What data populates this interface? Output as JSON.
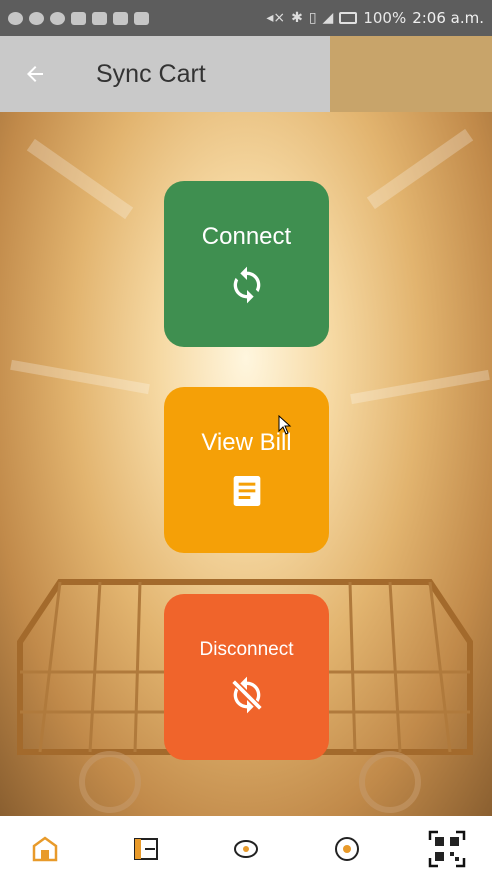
{
  "status_bar": {
    "battery_percent": "100%",
    "time": "2:06 a.m."
  },
  "app_bar": {
    "title": "Sync Cart",
    "back_icon": "arrow-back-icon"
  },
  "actions": {
    "connect_label": "Connect",
    "connect_icon": "sync-icon",
    "bill_label": "View Bill",
    "bill_icon": "document-icon",
    "disconnect_label": "Disconnect",
    "disconnect_icon": "sync-disabled-icon"
  },
  "colors": {
    "connect": "#3f8f50",
    "bill": "#f5a007",
    "disconnect": "#f0642b",
    "app_bar_accent": "#c8a46a"
  },
  "bottom_nav": {
    "items": [
      {
        "icon": "store-icon"
      },
      {
        "icon": "aisle-icon"
      },
      {
        "icon": "offers-icon"
      },
      {
        "icon": "search-product-icon"
      },
      {
        "icon": "qr-code-icon"
      }
    ]
  }
}
